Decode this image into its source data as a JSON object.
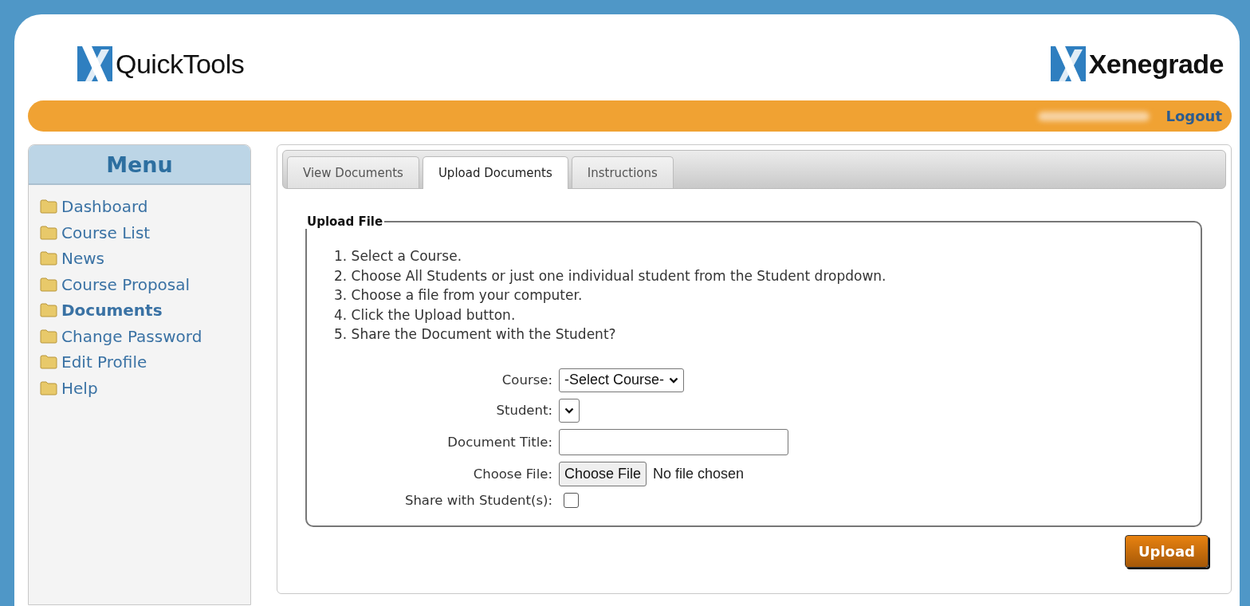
{
  "header": {
    "product_logo": "QuickTools",
    "company_logo": "Xenegrade"
  },
  "user_bar": {
    "logout": "Logout"
  },
  "menu": {
    "title": "Menu",
    "items": [
      {
        "label": "Dashboard",
        "selected": false
      },
      {
        "label": "Course List",
        "selected": false
      },
      {
        "label": "News",
        "selected": false
      },
      {
        "label": "Course Proposal",
        "selected": false
      },
      {
        "label": "Documents",
        "selected": true
      },
      {
        "label": "Change Password",
        "selected": false
      },
      {
        "label": "Edit Profile",
        "selected": false
      },
      {
        "label": "Help",
        "selected": false
      }
    ]
  },
  "tabs": [
    {
      "label": "View Documents",
      "selected": false
    },
    {
      "label": "Upload Documents",
      "selected": true
    },
    {
      "label": "Instructions",
      "selected": false
    }
  ],
  "upload_form": {
    "legend": "Upload File",
    "steps": [
      "1. Select a Course.",
      "2. Choose All Students or just one individual student from the Student dropdown.",
      "3. Choose a file from your computer.",
      "4. Click the Upload button.",
      "5. Share the Document with the Student?"
    ],
    "fields": [
      {
        "kind": "select",
        "label": "Course:",
        "value": "-Select Course-"
      },
      {
        "kind": "select",
        "label": "Student:"
      },
      {
        "kind": "text",
        "label": "Document Title:"
      },
      {
        "kind": "file",
        "label": "Choose File:",
        "button": "Choose File",
        "status": "No file chosen"
      },
      {
        "kind": "checkbox",
        "label": "Share with Student(s):",
        "checked": false
      }
    ]
  },
  "submit": "Upload"
}
